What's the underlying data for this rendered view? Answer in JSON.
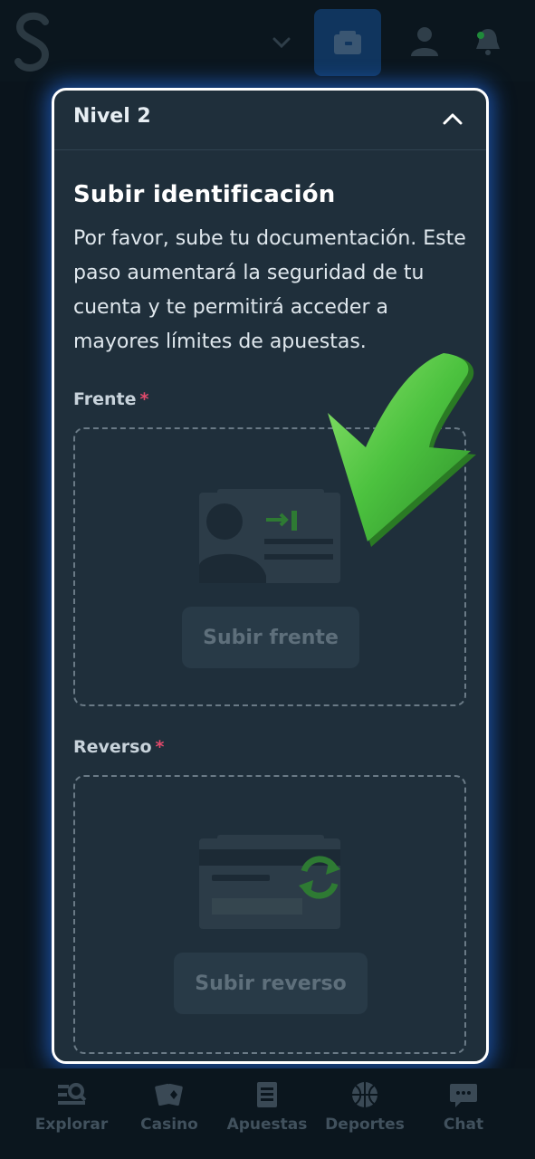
{
  "header": {
    "logo_icon": "brand-s-logo",
    "icons": [
      "chevron-down-icon",
      "wallet-icon",
      "user-icon",
      "bell-icon"
    ]
  },
  "card": {
    "level_title": "Nivel 2",
    "section_title": "Subir identificación",
    "description": "Por favor, sube tu documentación. Este paso aumentará la seguridad de tu cuenta y te permitirá acceder a mayores límites de apuestas.",
    "front": {
      "label": "Frente",
      "required_mark": "*",
      "button": "Subir frente",
      "icon": "id-card-front-icon"
    },
    "back": {
      "label": "Reverso",
      "required_mark": "*",
      "button": "Subir reverso",
      "icon": "id-card-back-icon"
    }
  },
  "nav": {
    "items": [
      {
        "label": "Explorar",
        "icon": "explore-icon"
      },
      {
        "label": "Casino",
        "icon": "cards-icon"
      },
      {
        "label": "Apuestas",
        "icon": "betslip-icon"
      },
      {
        "label": "Deportes",
        "icon": "basketball-icon"
      },
      {
        "label": "Chat",
        "icon": "chat-icon"
      }
    ]
  },
  "colors": {
    "card_bg": "#1f2f3b",
    "accent_green": "#3fae3f",
    "required_red": "#e04a6b",
    "wallet_bg": "#10355e"
  }
}
